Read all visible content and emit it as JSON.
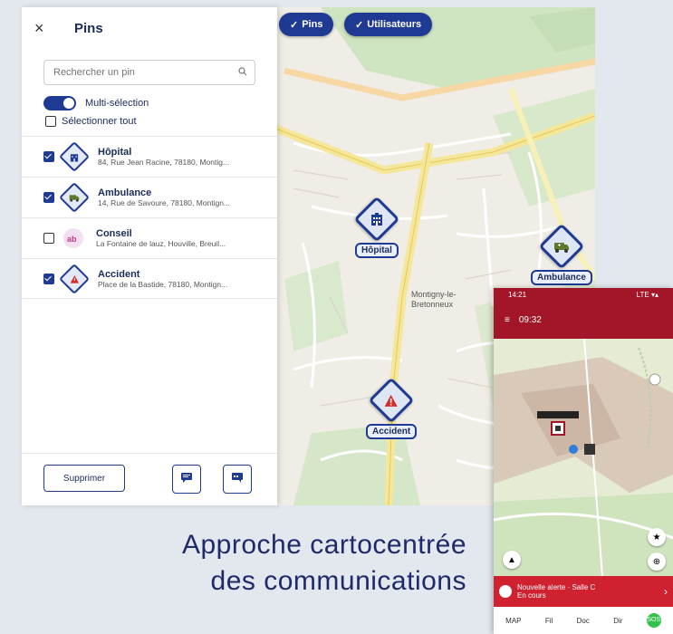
{
  "map_chips": [
    {
      "label": "Pins"
    },
    {
      "label": "Utilisateurs"
    }
  ],
  "map_markers": [
    {
      "label": "Hôpital"
    },
    {
      "label": "Ambulance"
    },
    {
      "label": "Accident"
    }
  ],
  "map_places": {
    "district": "Montigny-le-Bretonneux"
  },
  "panel": {
    "title": "Pins",
    "search_placeholder": "Rechercher un pin",
    "multiselect_label": "Multi-sélection",
    "select_all_label": "Sélectionner tout",
    "pins": [
      {
        "name": "Hôpital",
        "address": "84, Rue Jean Racine, 78180, Montig...",
        "checked": true
      },
      {
        "name": "Ambulance",
        "address": "14, Rue de Savoure, 78180, Montign...",
        "checked": true
      },
      {
        "name": "Conseil",
        "address": "La Fontaine de lauz, Houville, Breuil...",
        "checked": false
      },
      {
        "name": "Accident",
        "address": "Place de la Bastide, 78180, Montign...",
        "checked": true
      }
    ],
    "delete_label": "Supprimer"
  },
  "tagline": {
    "line1": "Approche cartocentrée",
    "line2": "des communications"
  },
  "phone": {
    "status_left": "14:21",
    "status_right": "LTE ▾▴",
    "topbar_label": "09:32",
    "alert_line1": "Nouvelle alerte · Salle C",
    "alert_line2": "En cours",
    "nav_items": [
      "MAP",
      "Fil",
      "Doc",
      "Dir",
      "SOS"
    ]
  },
  "colors": {
    "accent": "#1f3a93",
    "phone_red": "#a31528",
    "alert_red": "#cf2130"
  }
}
